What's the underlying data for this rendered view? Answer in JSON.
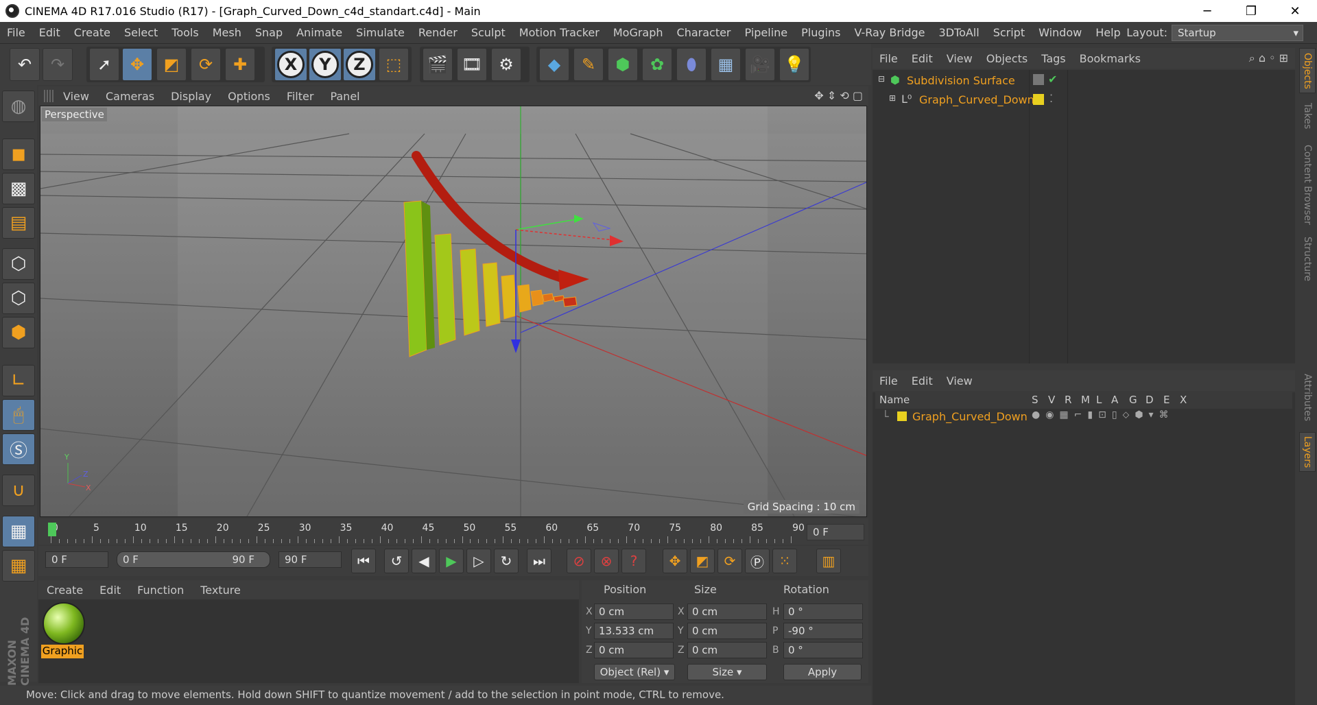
{
  "window": {
    "title": "CINEMA 4D R17.016 Studio (R17) - [Graph_Curved_Down_c4d_standart.c4d] - Main",
    "controls": [
      "─",
      "❐",
      "✕"
    ]
  },
  "menubar": {
    "items": [
      "File",
      "Edit",
      "Create",
      "Select",
      "Tools",
      "Mesh",
      "Snap",
      "Animate",
      "Simulate",
      "Render",
      "Sculpt",
      "Motion Tracker",
      "MoGraph",
      "Character",
      "Pipeline",
      "Plugins",
      "V-Ray Bridge",
      "3DToAll",
      "Script",
      "Window",
      "Help"
    ],
    "layout_label": "Layout:",
    "layout_value": "Startup"
  },
  "viewport": {
    "menu": [
      "View",
      "Cameras",
      "Display",
      "Options",
      "Filter",
      "Panel"
    ],
    "label": "Perspective",
    "grid_spacing": "Grid Spacing : 10 cm",
    "axis_labels": {
      "y": "Y",
      "z": "Z",
      "x": "X"
    }
  },
  "timeline": {
    "ticks": [
      "0",
      "5",
      "10",
      "15",
      "20",
      "25",
      "30",
      "35",
      "40",
      "45",
      "50",
      "55",
      "60",
      "65",
      "70",
      "75",
      "80",
      "85",
      "90"
    ],
    "current_frame": "0 F",
    "start_field": "0 F",
    "range_start": "0 F",
    "range_end": "90 F",
    "end_field": "90 F"
  },
  "material_manager": {
    "menu": [
      "Create",
      "Edit",
      "Function",
      "Texture"
    ],
    "material_name": "Graphic"
  },
  "coordinates": {
    "headers": {
      "position": "Position",
      "size": "Size",
      "rotation": "Rotation"
    },
    "rows": [
      {
        "axis": "X",
        "pos": "0 cm",
        "size_axis": "X",
        "size": "0 cm",
        "rot_axis": "H",
        "rot": "0 °"
      },
      {
        "axis": "Y",
        "pos": "13.533 cm",
        "size_axis": "Y",
        "size": "0 cm",
        "rot_axis": "P",
        "rot": "-90 °"
      },
      {
        "axis": "Z",
        "pos": "0 cm",
        "size_axis": "Z",
        "size": "0 cm",
        "rot_axis": "B",
        "rot": "0 °"
      }
    ],
    "mode": "Object (Rel)",
    "size_mode": "Size",
    "apply_label": "Apply"
  },
  "status": "Move: Click and drag to move elements. Hold down SHIFT to quantize movement / add to the selection in point mode, CTRL to remove.",
  "object_manager": {
    "menu": [
      "File",
      "Edit",
      "View",
      "Objects",
      "Tags",
      "Bookmarks"
    ],
    "objects": [
      "Subdivision Surface",
      "Graph_Curved_Down"
    ]
  },
  "layer_manager": {
    "menu": [
      "File",
      "Edit",
      "View"
    ],
    "columns": {
      "name": "Name",
      "s": "S",
      "v": "V",
      "r": "R",
      "m": "M",
      "l": "L",
      "a": "A",
      "g": "G",
      "d": "D",
      "e": "E",
      "x": "X"
    },
    "layer_name": "Graph_Curved_Down"
  },
  "side_tabs": [
    "Objects",
    "Takes",
    "Content Browser",
    "Structure",
    "Attributes",
    "Layers"
  ],
  "colors": {
    "accent": "#f0a020",
    "layer_yellow": "#e8d020",
    "selected_blue": "#5b7fa6"
  }
}
